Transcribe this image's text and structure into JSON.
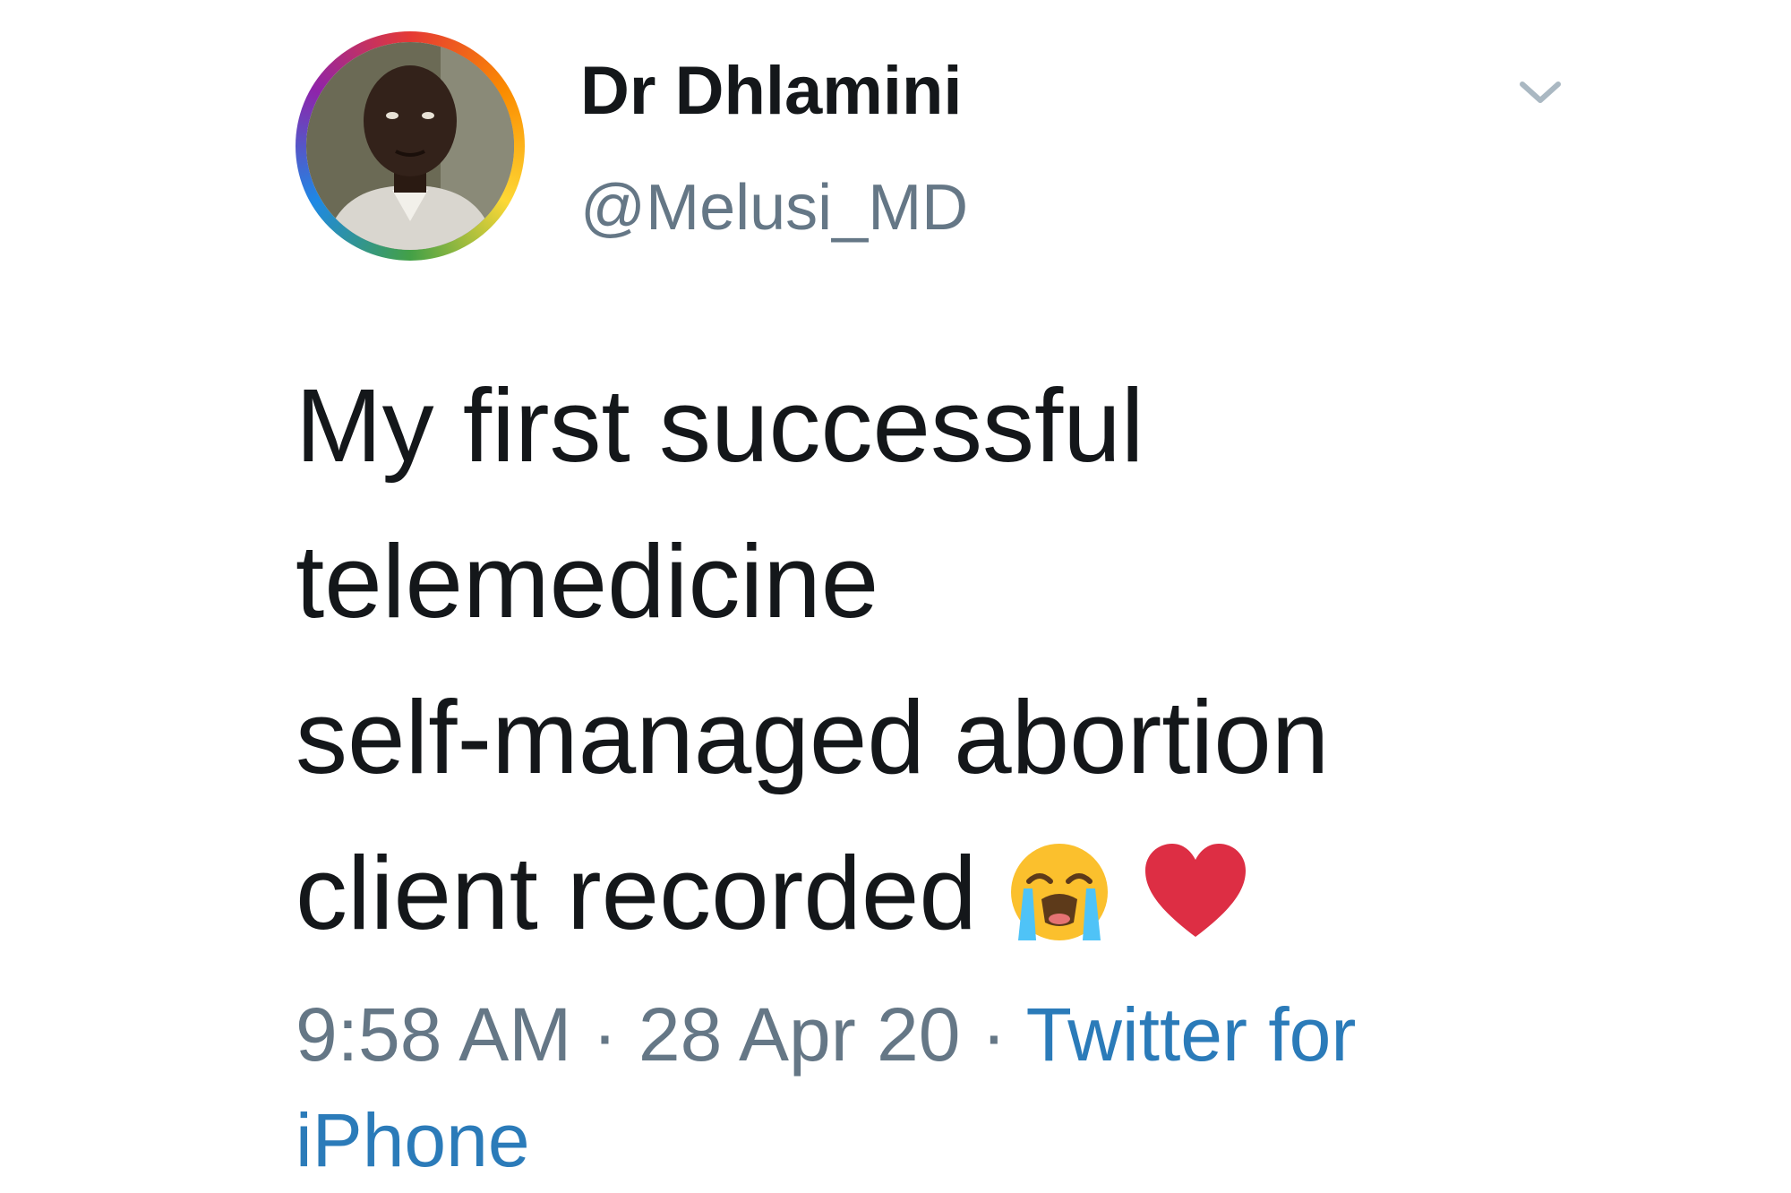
{
  "author": {
    "display_name": "Dr Dhlamini",
    "handle": "@Melusi_MD"
  },
  "tweet": {
    "lines": [
      "My first successful",
      "telemedicine",
      "self-managed abortion",
      "client recorded"
    ],
    "emojis": [
      "loudly-crying-face-icon",
      "red-heart-icon"
    ]
  },
  "meta": {
    "time": "9:58 AM",
    "separator": " · ",
    "date": "28 Apr 20",
    "source_line1": "Twitter for",
    "source_line2": "iPhone"
  },
  "colors": {
    "text": "#14171a",
    "secondary": "#657786",
    "link": "#2b7bb9"
  }
}
